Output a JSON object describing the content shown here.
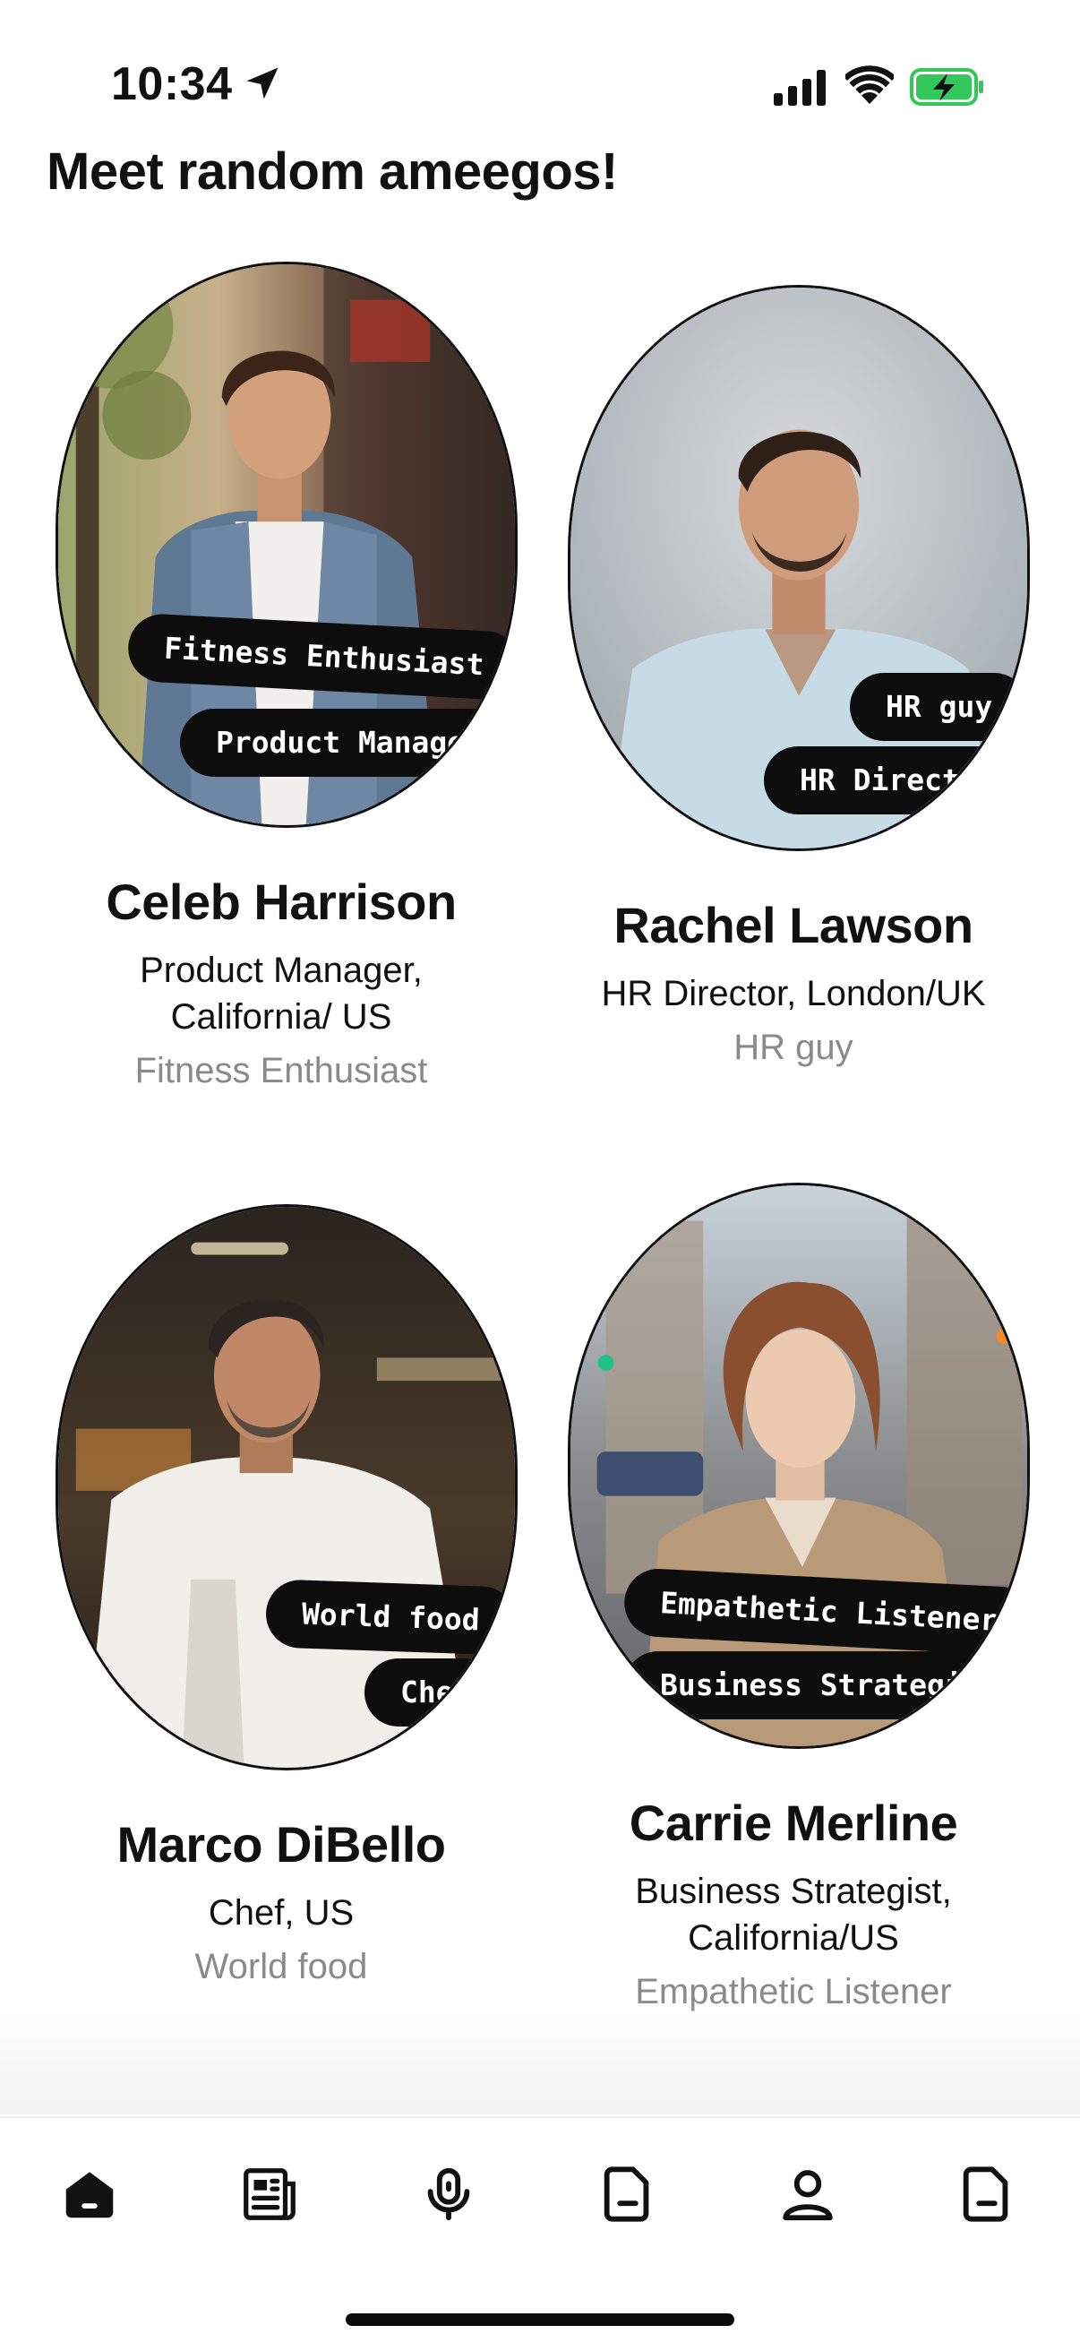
{
  "status_bar": {
    "time": "10:34"
  },
  "page": {
    "title": "Meet random ameegos!"
  },
  "profiles": [
    {
      "name": "Celeb Harrison",
      "role": "Product Manager, California/ US",
      "interest": "Fitness Enthusiast",
      "tags": [
        "Fitness Enthusiast",
        "Product Manager"
      ]
    },
    {
      "name": "Rachel Lawson",
      "role": "HR Director, London/UK",
      "interest": "HR guy",
      "tags": [
        "HR guy",
        "HR Director"
      ]
    },
    {
      "name": "Marco DiBello",
      "role": "Chef, US",
      "interest": "World food",
      "tags": [
        "World food",
        "Chef"
      ]
    },
    {
      "name": "Carrie Merline",
      "role": "Business Strategist, California/US",
      "interest": "Empathetic Listener",
      "tags": [
        "Empathetic Listener",
        "Business Strategist"
      ]
    }
  ],
  "tab_bar": {
    "items": [
      {
        "icon": "home-icon",
        "active": true
      },
      {
        "icon": "newspaper-icon",
        "active": false
      },
      {
        "icon": "microphone-icon",
        "active": false
      },
      {
        "icon": "document-icon",
        "active": false
      },
      {
        "icon": "profile-icon",
        "active": false
      },
      {
        "icon": "document-icon",
        "active": false
      }
    ]
  },
  "colors": {
    "background": "#ffffff",
    "tag_background": "#0d0d0d",
    "interest_text": "#8a8a8a"
  }
}
